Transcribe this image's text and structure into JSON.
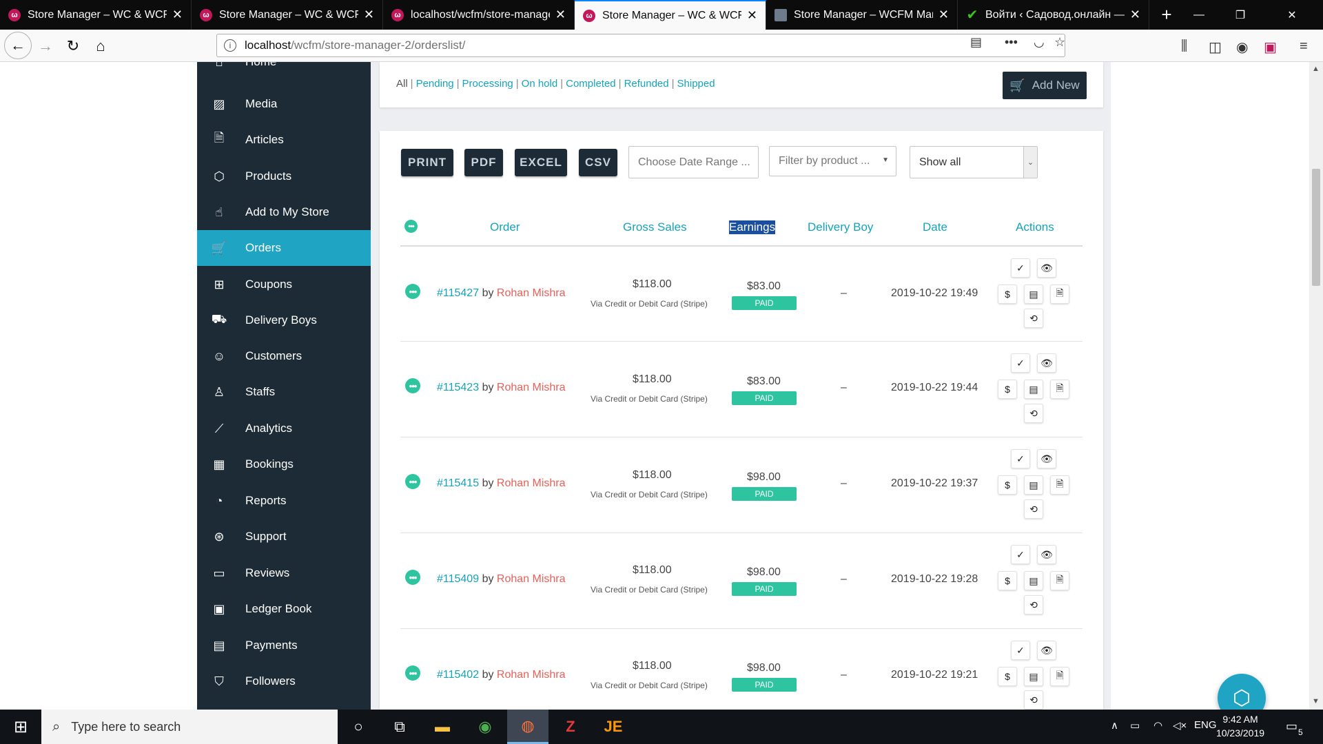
{
  "browser": {
    "tabs": [
      {
        "title": "Store Manager – WC & WCFM",
        "icon": "wcfm-favicon",
        "active": false
      },
      {
        "title": "Store Manager – WC & WCFM",
        "icon": "wcfm-favicon",
        "active": false
      },
      {
        "title": "localhost/wcfm/store-manage",
        "icon": "wcfm-favicon",
        "active": false
      },
      {
        "title": "Store Manager – WC & WCFM",
        "icon": "wcfm-favicon",
        "active": true
      },
      {
        "title": "Store Manager – WCFM Marke",
        "icon": "window-favicon",
        "active": false
      },
      {
        "title": "Войти ‹ Садовод.онлайн — W",
        "icon": "check-favicon",
        "active": false
      }
    ],
    "url_host": "localhost",
    "url_path": "/wcfm/store-manager-2/orderslist/"
  },
  "sidebar": {
    "items": [
      {
        "label": "Home",
        "icon": "home-icon",
        "glyph": "⌂"
      },
      {
        "label": "Media",
        "icon": "image-icon",
        "glyph": "▨"
      },
      {
        "label": "Articles",
        "icon": "document-icon",
        "glyph": "🗎"
      },
      {
        "label": "Products",
        "icon": "cube-icon",
        "glyph": "⬡"
      },
      {
        "label": "Add to My Store",
        "icon": "hand-pointer-icon",
        "glyph": "☝"
      },
      {
        "label": "Orders",
        "icon": "cart-icon",
        "glyph": "🛒"
      },
      {
        "label": "Coupons",
        "icon": "gift-icon",
        "glyph": "⊞"
      },
      {
        "label": "Delivery Boys",
        "icon": "truck-icon",
        "glyph": "⛟"
      },
      {
        "label": "Customers",
        "icon": "user-circle-icon",
        "glyph": "☺"
      },
      {
        "label": "Staffs",
        "icon": "user-icon",
        "glyph": "♙"
      },
      {
        "label": "Analytics",
        "icon": "chart-line-icon",
        "glyph": "⟋"
      },
      {
        "label": "Bookings",
        "icon": "calendar-icon",
        "glyph": "▦"
      },
      {
        "label": "Reports",
        "icon": "pie-chart-icon",
        "glyph": "◔"
      },
      {
        "label": "Support",
        "icon": "lifebuoy-icon",
        "glyph": "⊛"
      },
      {
        "label": "Reviews",
        "icon": "comment-icon",
        "glyph": "▭"
      },
      {
        "label": "Ledger Book",
        "icon": "money-bill-icon",
        "glyph": "▣"
      },
      {
        "label": "Payments",
        "icon": "credit-card-icon",
        "glyph": "▤"
      },
      {
        "label": "Followers",
        "icon": "shirt-icon",
        "glyph": "⛉"
      }
    ],
    "active_index": 5
  },
  "status_filter": {
    "all": "All",
    "links": [
      "Pending",
      "Processing",
      "On hold",
      "Completed",
      "Refunded",
      "Shipped"
    ],
    "separator": "|"
  },
  "add_new_label": "Add New",
  "export_buttons": [
    "PRINT",
    "PDF",
    "EXCEL",
    "CSV"
  ],
  "filters": {
    "date_placeholder": "Choose Date Range ...",
    "product_placeholder": "Filter by product ...",
    "show_value": "Show all"
  },
  "table": {
    "headers": [
      "Order",
      "Gross Sales",
      "Earnings",
      "Delivery Boy",
      "Date",
      "Actions"
    ],
    "by_label": "by",
    "rows": [
      {
        "order": "#115427",
        "customer": "Rohan Mishra",
        "gross": "$118.00",
        "via": "Via Credit or Debit Card (Stripe)",
        "earnings": "$83.00",
        "status": "PAID",
        "delivery": "–",
        "date": "2019-10-22 19:49"
      },
      {
        "order": "#115423",
        "customer": "Rohan Mishra",
        "gross": "$118.00",
        "via": "Via Credit or Debit Card (Stripe)",
        "earnings": "$83.00",
        "status": "PAID",
        "delivery": "–",
        "date": "2019-10-22 19:44"
      },
      {
        "order": "#115415",
        "customer": "Rohan Mishra",
        "gross": "$118.00",
        "via": "Via Credit or Debit Card (Stripe)",
        "earnings": "$98.00",
        "status": "PAID",
        "delivery": "–",
        "date": "2019-10-22 19:37"
      },
      {
        "order": "#115409",
        "customer": "Rohan Mishra",
        "gross": "$118.00",
        "via": "Via Credit or Debit Card (Stripe)",
        "earnings": "$98.00",
        "status": "PAID",
        "delivery": "–",
        "date": "2019-10-22 19:28"
      },
      {
        "order": "#115402",
        "customer": "Rohan Mishra",
        "gross": "$118.00",
        "via": "Via Credit or Debit Card (Stripe)",
        "earnings": "$98.00",
        "status": "PAID",
        "delivery": "–",
        "date": "2019-10-22 19:21"
      }
    ]
  },
  "taskbar": {
    "search_placeholder": "Type here to search",
    "language": "ENG",
    "time": "9:42 AM",
    "date": "10/23/2019",
    "notifications": "5"
  },
  "colors": {
    "sidebar_bg": "#1c2b36",
    "active_teal": "#20a4c4",
    "link": "#17a2b8",
    "customer": "#e8605a",
    "paid_green": "#2ec4a0"
  }
}
